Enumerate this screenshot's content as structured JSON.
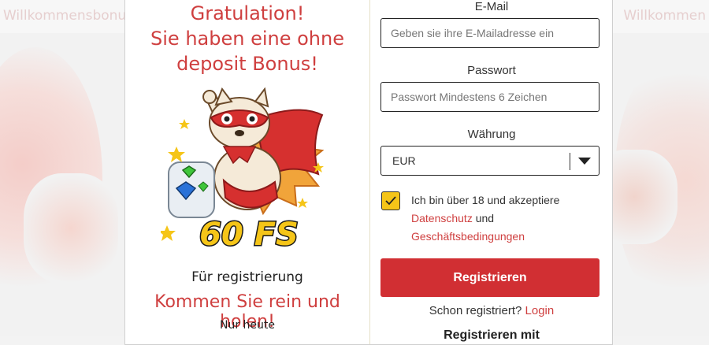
{
  "background": {
    "left_text": "Willkommensbonus",
    "right_text": "Willkommen"
  },
  "promo": {
    "headline_line1": "Gratulation!",
    "headline_line2": "Sie haben eine ohne",
    "headline_line3": "deposit Bonus!",
    "badge_text": "60 FS",
    "subtitle": "Für registrierung",
    "cta_text": "Kommen Sie rein und holen!",
    "note": "Nur heute"
  },
  "form": {
    "email_label": "E-Mail",
    "email_placeholder": "Geben sie ihre E-Mailadresse ein",
    "password_label": "Passwort",
    "password_placeholder": "Passwort Mindestens 6 Zeichen",
    "currency_label": "Währung",
    "currency_value": "EUR",
    "terms_checked": true,
    "terms_text": "Ich bin über 18 und akzeptiere",
    "privacy_link": "Datenschutz",
    "and_text": "und",
    "terms_link": "Geschäftsbedingungen",
    "register_button": "Registrieren",
    "already_text": "Schon registriert?",
    "login_link": "Login",
    "cut_text": "Registrieren mit"
  },
  "colors": {
    "accent_red": "#d12f33",
    "checkbox_yellow": "#f5c518"
  }
}
